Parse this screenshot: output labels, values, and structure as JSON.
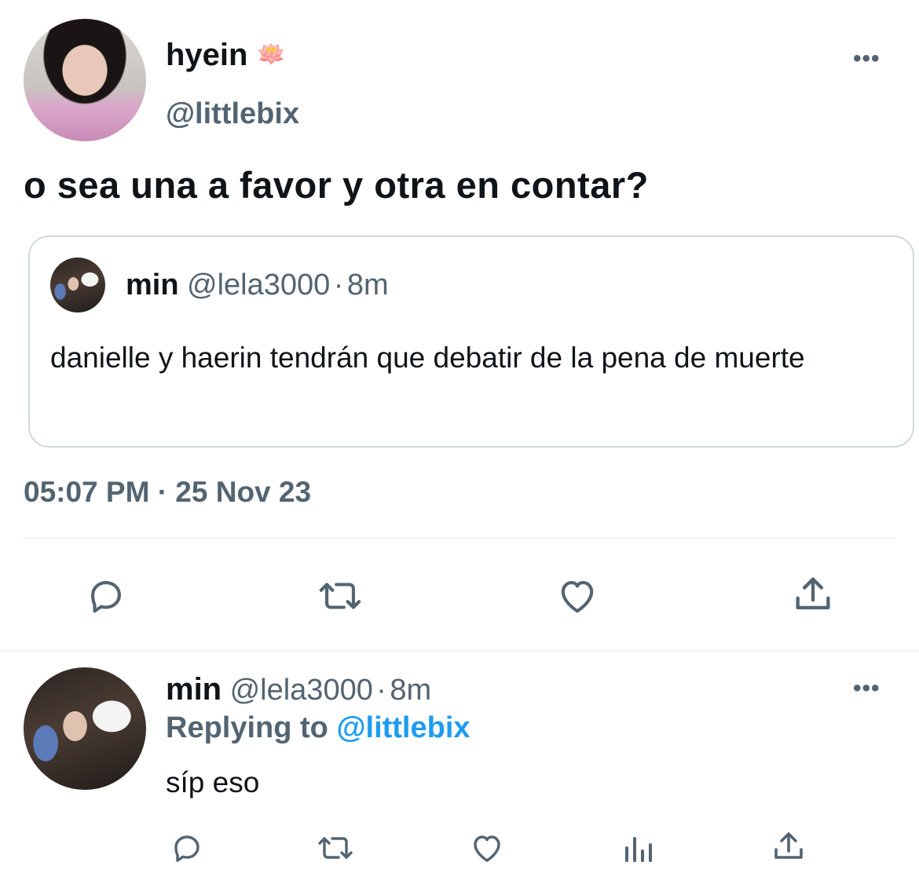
{
  "tweet": {
    "author_name": "hyein",
    "author_emoji": "🪷",
    "handle": "@littlebix",
    "text": "o sea una a favor y otra en contar?",
    "timestamp": "05:07 PM · 25 Nov 23",
    "more_label": "•••"
  },
  "quoted": {
    "author_name": "min",
    "handle": "@lela3000",
    "separator": "·",
    "age": "8m",
    "text": "danielle y haerin tendrán que debatir de la pena de muerte"
  },
  "actions": {
    "icons": [
      "reply-icon",
      "retweet-icon",
      "like-icon",
      "share-icon"
    ]
  },
  "reply": {
    "author_name": "min",
    "handle": "@lela3000",
    "separator": "·",
    "age": "8m",
    "replying_prefix": "Replying to",
    "replying_handle": "@littlebix",
    "text": "síp eso",
    "more_label": "•••",
    "icons": [
      "reply-icon",
      "retweet-icon",
      "like-icon",
      "analytics-icon",
      "share-icon"
    ]
  },
  "colors": {
    "text_primary": "#0f1419",
    "text_secondary": "#536471",
    "link": "#1d9bf0",
    "border": "#cfd9de",
    "divider": "#eff3f4"
  }
}
